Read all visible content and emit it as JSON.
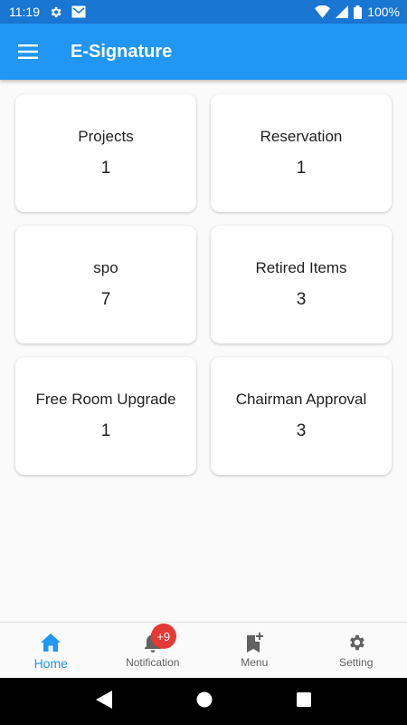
{
  "status_bar": {
    "time": "11:19",
    "battery": "100%"
  },
  "app_bar": {
    "title": "E-Signature",
    "menu_icon": "hamburger-menu-icon"
  },
  "cards": [
    {
      "title": "Projects",
      "count": "1"
    },
    {
      "title": "Reservation",
      "count": "1"
    },
    {
      "title": "spo",
      "count": "7"
    },
    {
      "title": "Retired Items",
      "count": "3"
    },
    {
      "title": "Free Room Upgrade",
      "count": "1"
    },
    {
      "title": "Chairman Approval",
      "count": "3"
    }
  ],
  "bottom_nav": {
    "items": [
      {
        "label": "Home",
        "icon": "home-icon",
        "active": true
      },
      {
        "label": "Notification",
        "icon": "bell-icon",
        "badge": "+9"
      },
      {
        "label": "Menu",
        "icon": "bookmark-add-icon"
      },
      {
        "label": "Setting",
        "icon": "gear-icon"
      }
    ]
  },
  "colors": {
    "primary": "#2196f3",
    "status_bar": "#1976d2",
    "badge": "#e53935"
  }
}
